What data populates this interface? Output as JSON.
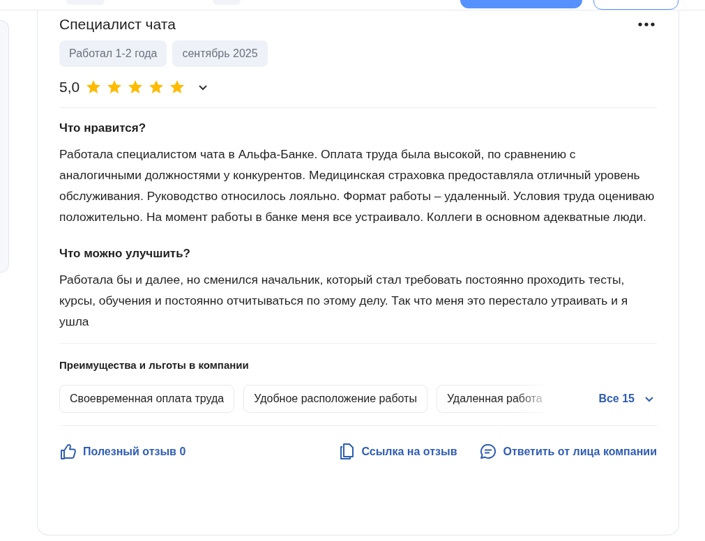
{
  "review": {
    "title": "Специалист чата",
    "tags": [
      "Работал 1-2 года",
      "сентябрь 2025"
    ],
    "rating": "5,0",
    "stars": 5,
    "sections": [
      {
        "heading": "Что нравится?",
        "text": "Работала специалистом чата в Альфа-Банке. Оплата труда была высокой, по сравнению с аналогичными должностями у конкурентов. Медицинская страховка предоставляла отличный уровень обслуживания. Руководство относилось лояльно. Формат работы – удаленный. Условия труда оцениваю положительно. На момент работы в банке меня все устраивало. Коллеги в основном адекватные люди."
      },
      {
        "heading": "Что можно улучшить?",
        "text": "Работала бы и далее, но сменился начальник, который стал требовать постоянно проходить тесты, курсы, обучения и постоянно отчитываться по этому делу. Так что меня это перестало утраивать и я ушла"
      }
    ],
    "benefits": {
      "heading": "Преимущества и льготы в компании",
      "items": [
        "Своевременная оплата труда",
        "Удобное расположение работы",
        "Удаленная работа"
      ],
      "more": "Все 15"
    },
    "actions": {
      "useful": "Полезный отзыв 0",
      "link": "Ссылка на отзыв",
      "reply": "Ответить от лица компании"
    }
  }
}
